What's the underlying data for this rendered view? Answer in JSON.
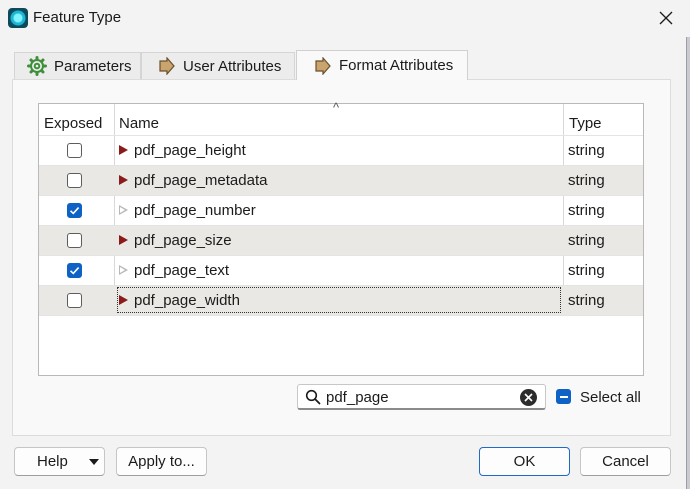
{
  "window": {
    "title": "Feature Type",
    "close_icon": "close-icon",
    "app_icon": "app-icon"
  },
  "tabs": [
    {
      "label": "Parameters",
      "icon": "gear-icon"
    },
    {
      "label": "User Attributes",
      "icon": "arrow-right-icon"
    },
    {
      "label": "Format Attributes",
      "icon": "arrow-right-icon",
      "active": true
    }
  ],
  "table": {
    "columns": [
      "Exposed",
      "Name",
      "Type"
    ],
    "sort_indicator": "^",
    "rows": [
      {
        "exposed": false,
        "name": "pdf_page_height",
        "type": "string"
      },
      {
        "exposed": false,
        "name": "pdf_page_metadata",
        "type": "string"
      },
      {
        "exposed": true,
        "name": "pdf_page_number",
        "type": "string"
      },
      {
        "exposed": false,
        "name": "pdf_page_size",
        "type": "string"
      },
      {
        "exposed": true,
        "name": "pdf_page_text",
        "type": "string"
      },
      {
        "exposed": false,
        "name": "pdf_page_width",
        "type": "string"
      }
    ]
  },
  "search": {
    "value": "pdf_page",
    "icon": "search-icon",
    "clear_icon": "clear-icon"
  },
  "select_all": {
    "label": "Select all",
    "state": "partial"
  },
  "buttons": {
    "help": "Help",
    "apply_to": "Apply to...",
    "ok": "OK",
    "cancel": "Cancel"
  },
  "colors": {
    "accent": "#0f62c5",
    "row_alt": "#e9e8e4",
    "attr_marker": "#8b1a1a"
  }
}
